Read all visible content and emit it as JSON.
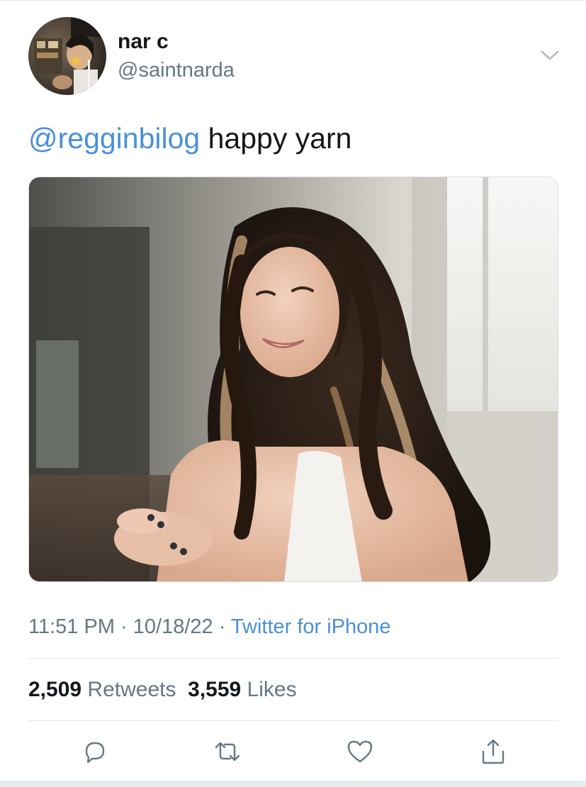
{
  "user": {
    "display_name": "nar c",
    "handle": "@saintnarda"
  },
  "tweet": {
    "mention": "@regginbilog",
    "text": " happy yarn"
  },
  "meta": {
    "time": "11:51 PM",
    "separator1": " · ",
    "date": "10/18/22",
    "separator2": " · ",
    "source": "Twitter for iPhone"
  },
  "stats": {
    "retweets_count": "2,509",
    "retweets_label": "Retweets",
    "likes_count": "3,559",
    "likes_label": "Likes"
  },
  "icons": {
    "menu": "chevron-down-icon",
    "reply": "reply-icon",
    "retweet": "retweet-icon",
    "like": "heart-icon",
    "share": "share-icon"
  },
  "colors": {
    "link": "#4a90d9",
    "text": "#14171a",
    "muted": "#657786",
    "icon": "#657786"
  }
}
